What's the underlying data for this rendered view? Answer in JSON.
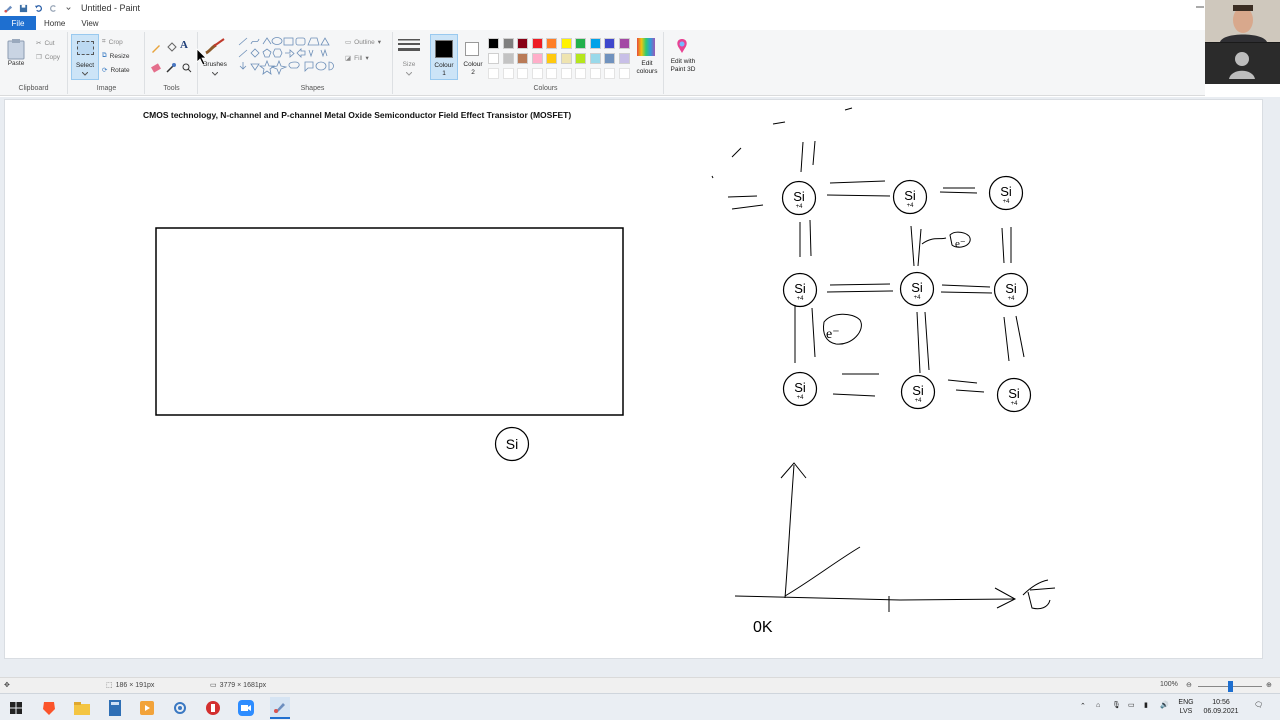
{
  "window": {
    "title": "Untitled - Paint"
  },
  "menu": {
    "file": "File",
    "home": "Home",
    "view": "View"
  },
  "ribbon": {
    "clipboard": {
      "label": "Clipboard",
      "paste": "Paste",
      "cut": "Cut",
      "copy": "Copy"
    },
    "image": {
      "label": "Image",
      "select": "Select",
      "crop": "Crop",
      "resize": "Resize",
      "rotate": "Rotate"
    },
    "tools": {
      "label": "Tools"
    },
    "brushes": {
      "label": "Brushes"
    },
    "shapes": {
      "label": "Shapes",
      "outline": "Outline",
      "fill": "Fill"
    },
    "size": {
      "label": "Size"
    },
    "colours": {
      "label": "Colours",
      "colour1": "Colour\n1",
      "colour2": "Colour\n2",
      "edit": "Edit\ncolours",
      "paint3d": "Edit with\nPaint 3D",
      "colour1_value": "#000000",
      "colour2_value": "#ffffff",
      "palette_row1": [
        "#000000",
        "#7f7f7f",
        "#880015",
        "#ed1c24",
        "#ff7f27",
        "#fff200",
        "#22b14c",
        "#00a2e8",
        "#3f48cc",
        "#a349a4"
      ],
      "palette_row2": [
        "#ffffff",
        "#c3c3c3",
        "#b97a57",
        "#ffaec9",
        "#ffc90e",
        "#efe4b0",
        "#b5e61d",
        "#99d9ea",
        "#7092be",
        "#c8bfe7"
      ]
    }
  },
  "canvas": {
    "heading": "CMOS technology, N-channel and P-channel Metal Oxide Semiconductor Field Effect Transistor (MOSFET)",
    "si_label": "Si",
    "charge_label": "+4",
    "electron_label": "e⁻",
    "graph_origin": "0K",
    "graph_arrow": "T"
  },
  "status": {
    "selection_size": "186 × 191px",
    "image_size": "3779 × 1681px",
    "zoom": "100%"
  },
  "taskbar": {
    "lang1": "ENG",
    "lang2": "LVS",
    "time": "10:56",
    "date": "06.09.2021"
  }
}
